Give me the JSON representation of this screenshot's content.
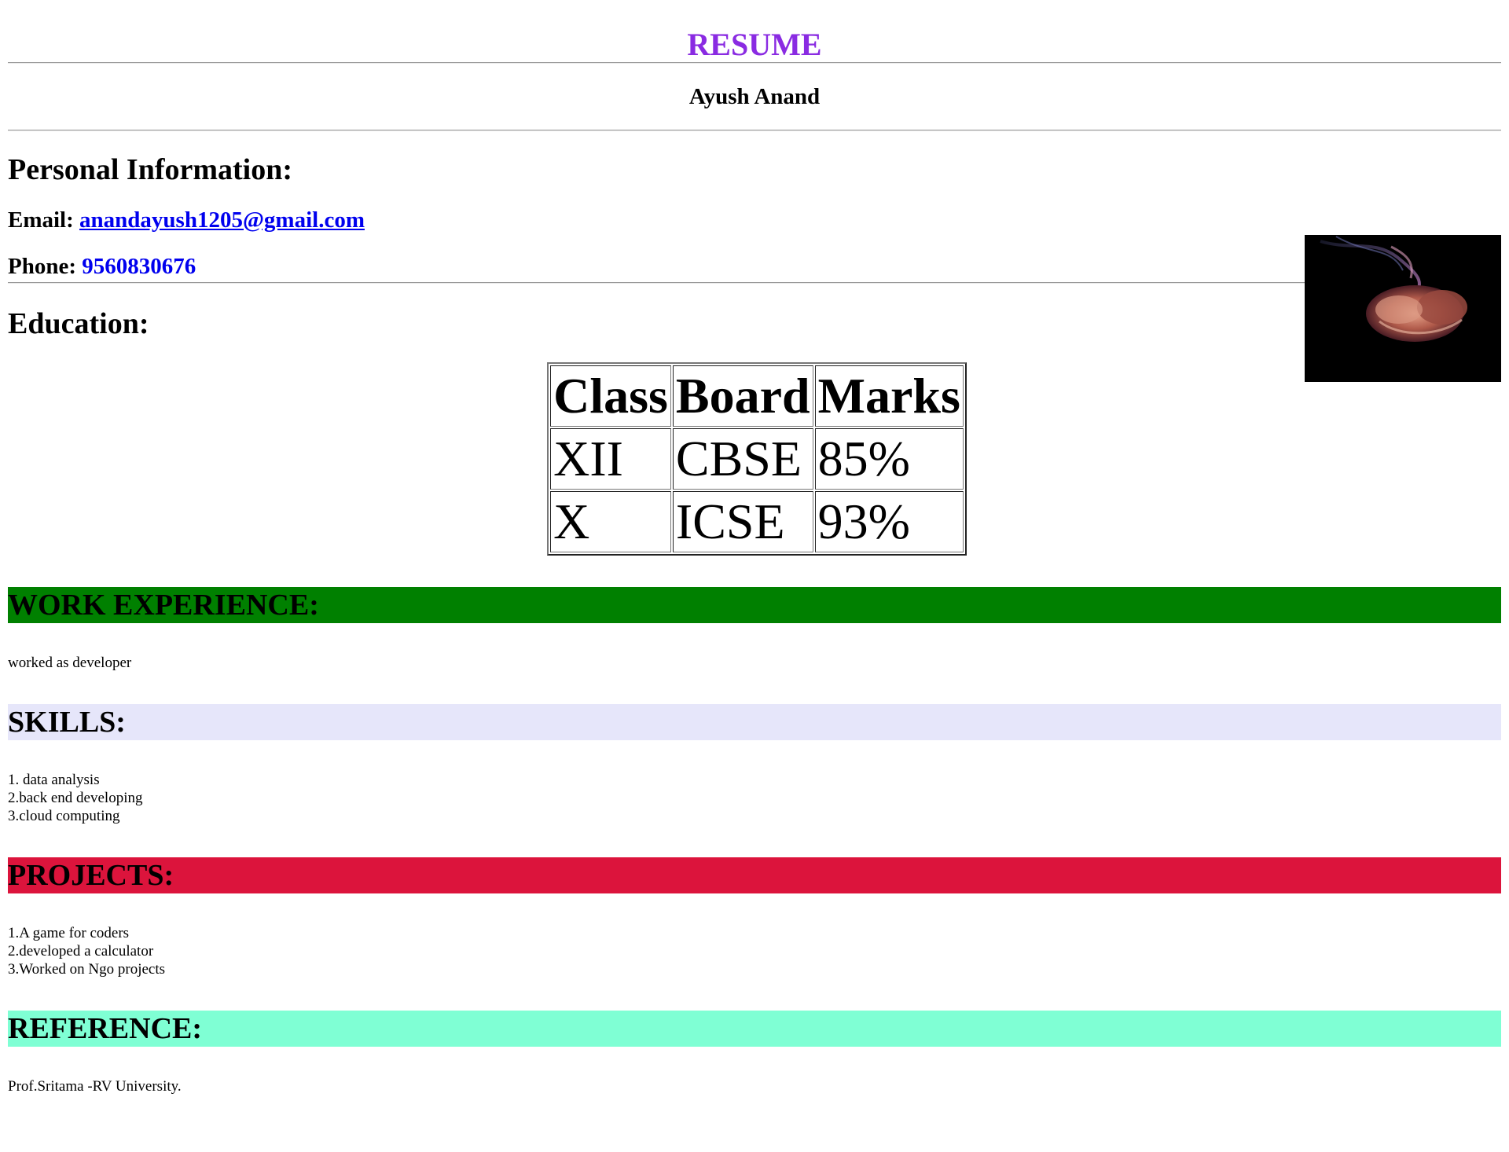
{
  "page": {
    "title": "RESUME",
    "title_color": "#8a2be2"
  },
  "header": {
    "name": "Ayush Anand"
  },
  "personal": {
    "heading": "Personal Information:",
    "email_label": "Email:",
    "email": "anandayush1205@gmail.com",
    "phone_label": "Phone:",
    "phone": "9560830676",
    "link_color": "#0000ee"
  },
  "photo": {
    "icon": "smoke-photo"
  },
  "education": {
    "heading": "Education:",
    "columns": [
      "Class",
      "Board",
      "Marks"
    ],
    "rows": [
      [
        "XII",
        "CBSE",
        "85%"
      ],
      [
        "X",
        "ICSE",
        "93%"
      ]
    ]
  },
  "work": {
    "heading": "WORK EXPERIENCE:",
    "color": "#008000",
    "text": "worked as developer"
  },
  "skills": {
    "heading": "SKILLS:",
    "color": "#e6e6fa",
    "items": [
      "1. data analysis",
      "2.back end developing",
      "3.cloud computing"
    ]
  },
  "projects": {
    "heading": "PROJECTS:",
    "color": "#dc143c",
    "items": [
      "1.A game for coders",
      "2.developed a calculator",
      "3.Worked on Ngo projects"
    ]
  },
  "reference": {
    "heading": "REFERENCE:",
    "color": "#7fffd4",
    "text": "Prof.Sritama -RV University."
  }
}
